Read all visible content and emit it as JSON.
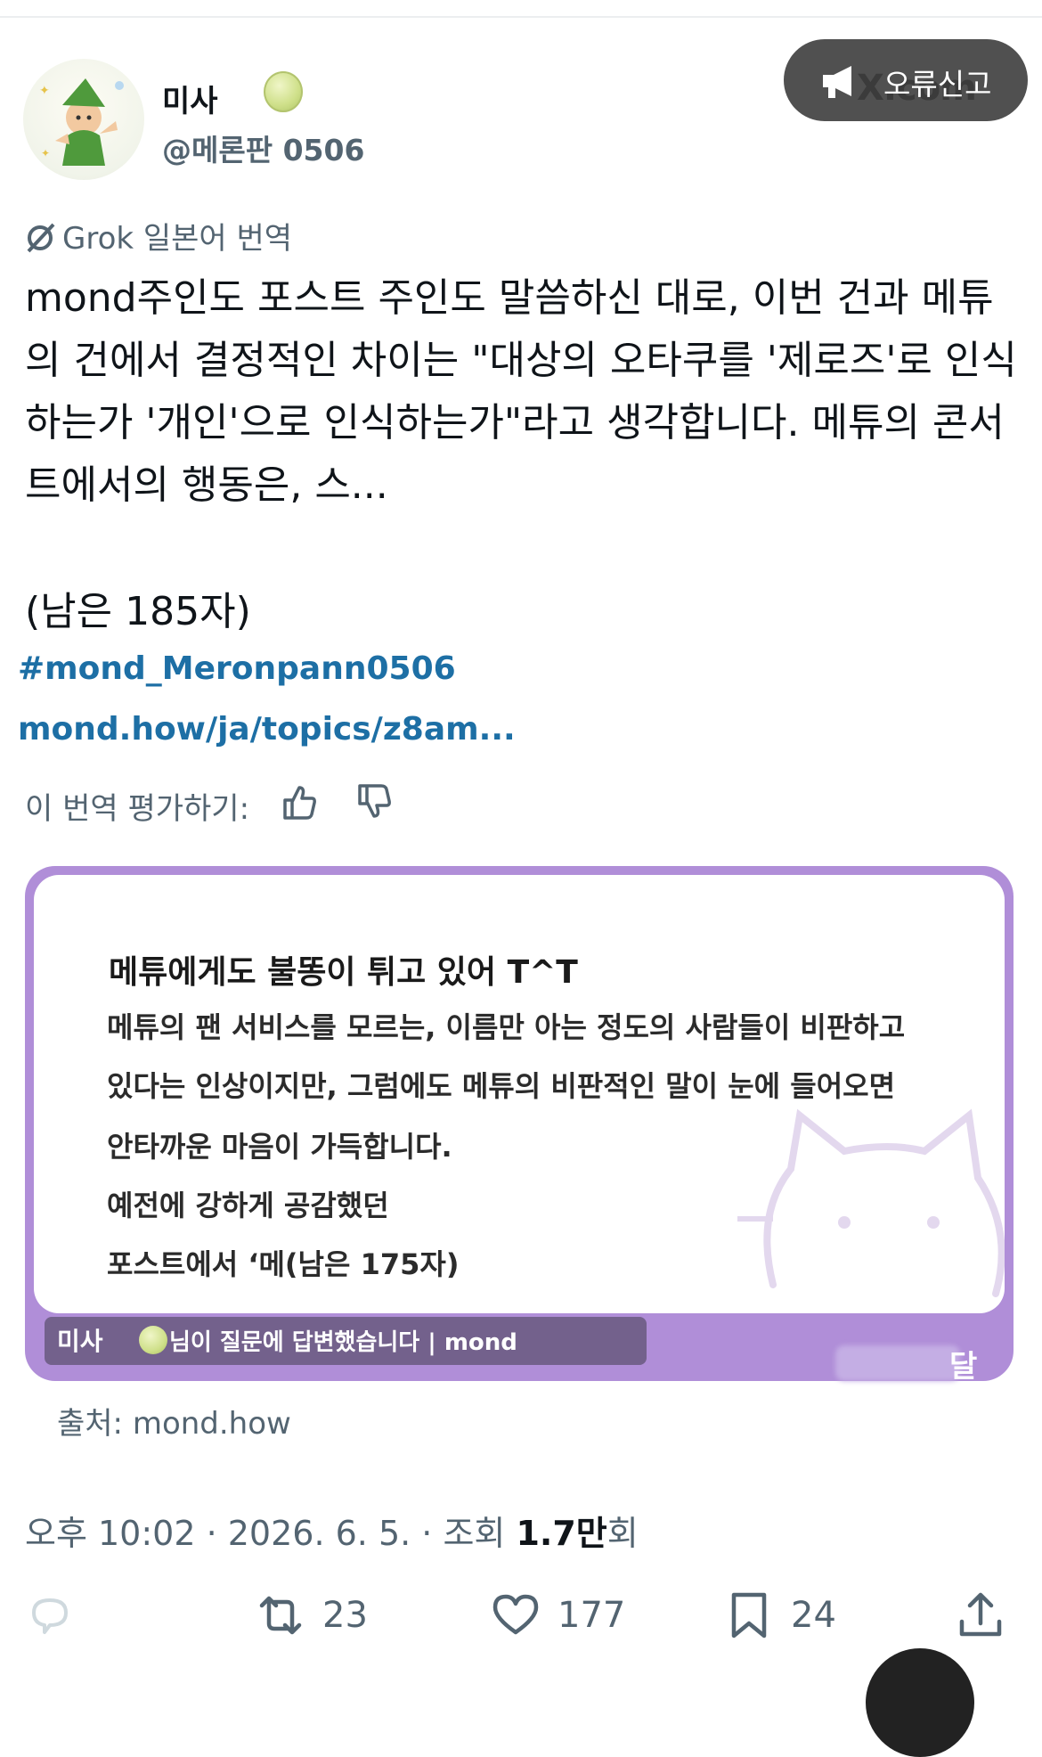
{
  "author": {
    "name": "미사",
    "handle": "@메론판 0506"
  },
  "report_button": {
    "label": "오류신고",
    "watermark": "X.com"
  },
  "translation": {
    "badge": "Grok 일본어 번역",
    "body": "mond주인도 포스트 주인도 말씀하신 대로, 이번 건과 메튜의 건에서 결정적인 차이는 \"대상의 오타쿠를 '제로즈'로 인식하는가 '개인'으로 인식하는가\"라고 생각합니다. 메튜의 콘서트에서의 행동은, 스...",
    "remaining": "(남은 185자)",
    "hashtag": "#mond_Meronpann0506",
    "link": "mond.how/ja/topics/z8am...",
    "rate_label": "이 번역 평가하기:"
  },
  "card": {
    "title": "메튜에게도 불똥이 튀고 있어 T^T",
    "lines": [
      "메튜의 팬 서비스를 모르는, 이름만 아는 정도의 사람들이 비판하고",
      "있다는 인상이지만, 그럼에도 메튜의 비판적인 말이 눈에 들어오면",
      "안타까운 마음이 가득합니다.",
      "예전에 강하게 공감했던",
      "포스트에서 ‘메(남은 175자)"
    ],
    "footer_name": "미사",
    "footer_text": "님이 질문에 답변했습니다 | mond",
    "corner": "달"
  },
  "source": "출처: mond.how",
  "meta": {
    "time": "오후 10:02 · 2026. 6. 5. · 조회 ",
    "views": "1.7만",
    "views_suffix": "회"
  },
  "actions": {
    "retweets": "23",
    "likes": "177",
    "bookmarks": "24"
  },
  "colors": {
    "link": "#1d6fa5",
    "card_border": "#b08ed8",
    "muted": "#536471"
  }
}
